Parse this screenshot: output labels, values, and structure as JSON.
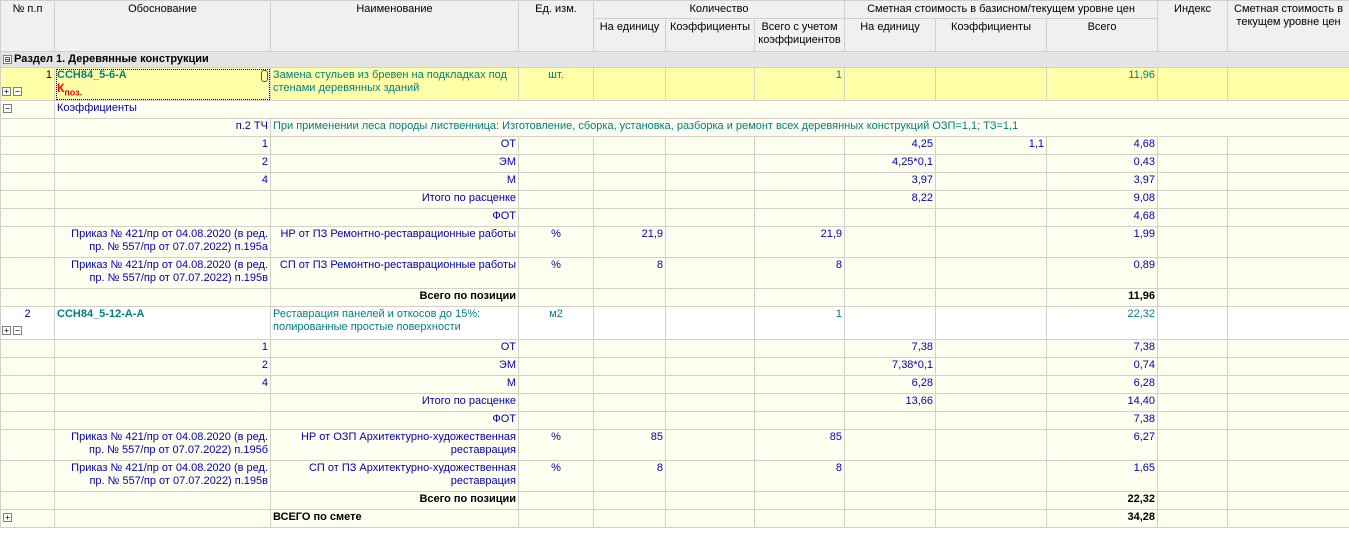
{
  "header": {
    "num": "№ п.п",
    "basis": "Обоснование",
    "name": "Наименование",
    "unit": "Ед. изм.",
    "qty": "Количество",
    "qty_per_unit": "На единицу",
    "qty_coef": "Коэффициенты",
    "qty_total": "Всего с учетом коэффициентов",
    "cost": "Сметная стоимость в базисном/текущем уровне цен",
    "cost_per_unit": "На единицу",
    "cost_coef": "Коэффициенты",
    "cost_total": "Всего",
    "index": "Индекс",
    "cost_current": "Сметная стоимость в текущем уровне цен"
  },
  "section": {
    "expander": "⊟",
    "title": "Раздел 1. Деревянные конструкции"
  },
  "item1": {
    "num": "1",
    "code": "ССН84_5-6-А",
    "k_mark": "К",
    "k_sub": "поз.",
    "name": "Замена стульев из бревен на подкладках под стенами деревянных зданий",
    "unit": "шт.",
    "qty_total": "1",
    "cost_total": "11,96",
    "coef_label": "Коэффициенты",
    "coef_ref": "п.2 ТЧ",
    "coef_text": "При применении леса породы лиственница: Изготовление, сборка, установка, разборка и ремонт всех деревянных конструкций  ОЗП=1,1; ТЗ=1,1",
    "rows": [
      {
        "num": "1",
        "name": "ОТ",
        "per_unit": "4,25",
        "coef": "1,1",
        "total": "4,68"
      },
      {
        "num": "2",
        "name": "ЭМ",
        "per_unit": "4,25*0,1",
        "coef": "",
        "total": "0,43"
      },
      {
        "num": "4",
        "name": "М",
        "per_unit": "3,97",
        "coef": "",
        "total": "3,97"
      }
    ],
    "itogo_label": "Итого по расценке",
    "itogo_per_unit": "8,22",
    "itogo_total": "9,08",
    "fot_label": "ФОТ",
    "fot_total": "4,68",
    "nr": {
      "basis": "Приказ № 421/пр от 04.08.2020 (в ред. пр. № 557/пр от 07.07.2022) п.195а",
      "name": "НР от ПЗ Ремонтно-реставрационные работы",
      "unit": "%",
      "qty": "21,9",
      "qty_total": "21,9",
      "total": "1,99"
    },
    "sp": {
      "basis": "Приказ № 421/пр от 04.08.2020 (в ред. пр. № 557/пр от 07.07.2022) п.195в",
      "name": "СП от ПЗ Ремонтно-реставрационные работы",
      "unit": "%",
      "qty": "8",
      "qty_total": "8",
      "total": "0,89"
    },
    "total_label": "Всего по позиции",
    "total": "11,96"
  },
  "item2": {
    "num": "2",
    "code": "ССН84_5-12-А-А",
    "name": "Реставрация панелей и откосов до 15%: полированные простые поверхности",
    "unit": "м2",
    "qty_total": "1",
    "cost_total": "22,32",
    "rows": [
      {
        "num": "1",
        "name": "ОТ",
        "per_unit": "7,38",
        "total": "7,38"
      },
      {
        "num": "2",
        "name": "ЭМ",
        "per_unit": "7,38*0,1",
        "total": "0,74"
      },
      {
        "num": "4",
        "name": "М",
        "per_unit": "6,28",
        "total": "6,28"
      }
    ],
    "itogo_label": "Итого по расценке",
    "itogo_per_unit": "13,66",
    "itogo_total": "14,40",
    "fot_label": "ФОТ",
    "fot_total": "7,38",
    "nr": {
      "basis": "Приказ № 421/пр от 04.08.2020 (в ред. пр. № 557/пр от 07.07.2022) п.195б",
      "name": "НР от ОЗП Архитектурно-художественная реставрация",
      "unit": "%",
      "qty": "85",
      "qty_total": "85",
      "total": "6,27"
    },
    "sp": {
      "basis": "Приказ № 421/пр от 04.08.2020 (в ред. пр. № 557/пр от 07.07.2022) п.195в",
      "name": "СП от ПЗ Архитектурно-художественная реставрация",
      "unit": "%",
      "qty": "8",
      "qty_total": "8",
      "total": "1,65"
    },
    "total_label": "Всего по позиции",
    "total": "22,32"
  },
  "grand": {
    "label": "ВСЕГО по смете",
    "total": "34,28"
  }
}
